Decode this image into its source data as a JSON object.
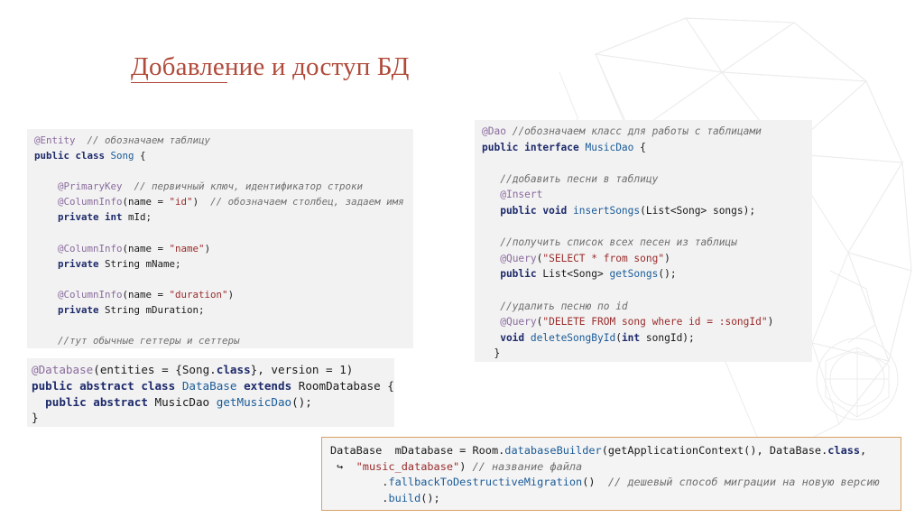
{
  "slide": {
    "title": "Добавление и доступ БД"
  },
  "entity_code": {
    "lines": [
      [
        {
          "t": "@Entity",
          "c": "ann"
        },
        {
          "t": "  "
        },
        {
          "t": "// обозначаем таблицу",
          "c": "cm"
        }
      ],
      [
        {
          "t": "public class ",
          "c": "kw"
        },
        {
          "t": "Song",
          "c": "cls"
        },
        {
          "t": " {"
        }
      ],
      [
        {
          "t": ""
        }
      ],
      [
        {
          "t": "    "
        },
        {
          "t": "@PrimaryKey",
          "c": "ann"
        },
        {
          "t": "  "
        },
        {
          "t": "// первичный ключ, идентификатор строки",
          "c": "cm"
        }
      ],
      [
        {
          "t": "    "
        },
        {
          "t": "@ColumnInfo",
          "c": "ann"
        },
        {
          "t": "(name = "
        },
        {
          "t": "\"id\"",
          "c": "str"
        },
        {
          "t": ")  "
        },
        {
          "t": "// обозначаем столбец, задаем имя",
          "c": "cm"
        }
      ],
      [
        {
          "t": "    private int ",
          "c": "kw"
        },
        {
          "t": "mId;"
        }
      ],
      [
        {
          "t": ""
        }
      ],
      [
        {
          "t": "    "
        },
        {
          "t": "@ColumnInfo",
          "c": "ann"
        },
        {
          "t": "(name = "
        },
        {
          "t": "\"name\"",
          "c": "str"
        },
        {
          "t": ")"
        }
      ],
      [
        {
          "t": "    private ",
          "c": "kw"
        },
        {
          "t": "String mName;"
        }
      ],
      [
        {
          "t": ""
        }
      ],
      [
        {
          "t": "    "
        },
        {
          "t": "@ColumnInfo",
          "c": "ann"
        },
        {
          "t": "(name = "
        },
        {
          "t": "\"duration\"",
          "c": "str"
        },
        {
          "t": ")"
        }
      ],
      [
        {
          "t": "    private ",
          "c": "kw"
        },
        {
          "t": "String mDuration;"
        }
      ],
      [
        {
          "t": ""
        }
      ],
      [
        {
          "t": "    "
        },
        {
          "t": "//тут обычные геттеры и сеттеры",
          "c": "cm"
        }
      ],
      [
        {
          "t": "}"
        }
      ]
    ]
  },
  "dao_code": {
    "lines": [
      [
        {
          "t": "@Dao",
          "c": "ann"
        },
        {
          "t": " "
        },
        {
          "t": "//обозначаем класс для работы с таблицами",
          "c": "cm"
        }
      ],
      [
        {
          "t": "public interface ",
          "c": "kw"
        },
        {
          "t": "MusicDao",
          "c": "cls"
        },
        {
          "t": " {"
        }
      ],
      [
        {
          "t": ""
        }
      ],
      [
        {
          "t": "   "
        },
        {
          "t": "//добавить песни в таблицу",
          "c": "cm"
        }
      ],
      [
        {
          "t": "   "
        },
        {
          "t": "@Insert",
          "c": "ann"
        }
      ],
      [
        {
          "t": "   public void ",
          "c": "kw"
        },
        {
          "t": "insertSongs",
          "c": "fn"
        },
        {
          "t": "(List<Song> songs);"
        }
      ],
      [
        {
          "t": ""
        }
      ],
      [
        {
          "t": "   "
        },
        {
          "t": "//получить список всех песен из таблицы",
          "c": "cm"
        }
      ],
      [
        {
          "t": "   "
        },
        {
          "t": "@Query",
          "c": "ann"
        },
        {
          "t": "("
        },
        {
          "t": "\"SELECT * from song\"",
          "c": "str"
        },
        {
          "t": ")"
        }
      ],
      [
        {
          "t": "   public ",
          "c": "kw"
        },
        {
          "t": "List<Song> "
        },
        {
          "t": "getSongs",
          "c": "fn"
        },
        {
          "t": "();"
        }
      ],
      [
        {
          "t": ""
        }
      ],
      [
        {
          "t": "   "
        },
        {
          "t": "//удалить песню по id",
          "c": "cm"
        }
      ],
      [
        {
          "t": "   "
        },
        {
          "t": "@Query",
          "c": "ann"
        },
        {
          "t": "("
        },
        {
          "t": "\"DELETE FROM song where id = :songId\"",
          "c": "str"
        },
        {
          "t": ")"
        }
      ],
      [
        {
          "t": "   void ",
          "c": "kw"
        },
        {
          "t": "deleteSongById",
          "c": "fn"
        },
        {
          "t": "("
        },
        {
          "t": "int ",
          "c": "kw"
        },
        {
          "t": "songId);"
        }
      ],
      [
        {
          "t": "  }"
        }
      ]
    ]
  },
  "database_code": {
    "lines": [
      [
        {
          "t": "@Database",
          "c": "ann"
        },
        {
          "t": "(entities = {Song."
        },
        {
          "t": "class",
          "c": "kw"
        },
        {
          "t": "}, version = 1)"
        }
      ],
      [
        {
          "t": "public abstract class ",
          "c": "kw"
        },
        {
          "t": "DataBase",
          "c": "cls"
        },
        {
          "t": " "
        },
        {
          "t": "extends",
          "c": "kw"
        },
        {
          "t": " RoomDatabase {"
        }
      ],
      [
        {
          "t": "  public abstract ",
          "c": "kw"
        },
        {
          "t": "MusicDao "
        },
        {
          "t": "getMusicDao",
          "c": "fn"
        },
        {
          "t": "();"
        }
      ],
      [
        {
          "t": "}"
        }
      ]
    ]
  },
  "builder_code": {
    "lines": [
      [
        {
          "t": "DataBase  mDatabase = Room."
        },
        {
          "t": "databaseBuilder",
          "c": "fn"
        },
        {
          "t": "(getApplicationContext(), DataBase."
        },
        {
          "t": "class",
          "c": "kw"
        },
        {
          "t": ","
        }
      ],
      [
        {
          "t": " ↪  "
        },
        {
          "t": "\"music_database\"",
          "c": "str"
        },
        {
          "t": ") "
        },
        {
          "t": "// название файла",
          "c": "cm"
        }
      ],
      [
        {
          "t": "        ."
        },
        {
          "t": "fallbackToDestructiveMigration",
          "c": "fn"
        },
        {
          "t": "()  "
        },
        {
          "t": "// дешевый способ миграции на новую версию",
          "c": "cm"
        }
      ],
      [
        {
          "t": "        ."
        },
        {
          "t": "build",
          "c": "fn"
        },
        {
          "t": "();"
        }
      ]
    ]
  }
}
